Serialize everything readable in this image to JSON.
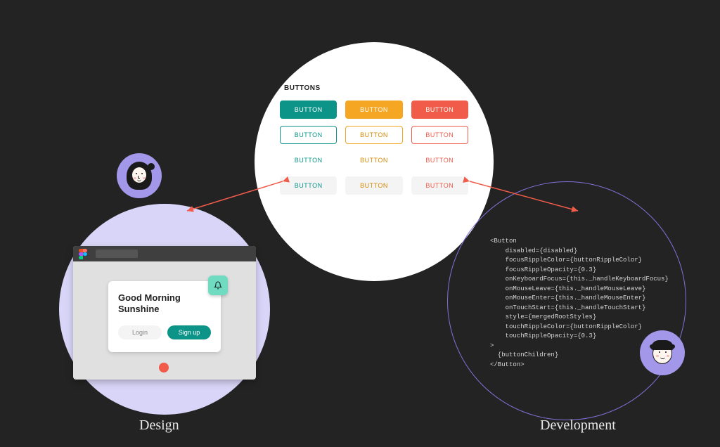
{
  "labels": {
    "design": "Design",
    "development": "Development"
  },
  "center": {
    "title": "BUTTONS",
    "button_text": "BUTTON"
  },
  "colors": {
    "teal": "#0d9488",
    "amber": "#f5a623",
    "red": "#f05b4a",
    "lavender": "#d9d5f8",
    "avatar": "#a397ea",
    "bg": "#232323"
  },
  "mockup": {
    "title_line1": "Good Morning",
    "title_line2": "Sunshine",
    "login": "Login",
    "signup": "Sign up"
  },
  "code": {
    "l0": "<Button",
    "l1": "    disabled={disabled}",
    "l2": "    focusRippleColor={buttonRippleColor}",
    "l3": "    focusRippleOpacity={0.3}",
    "l4": "    onKeyboardFocus={this._handleKeyboardFocus}",
    "l5": "    onMouseLeave={this._handleMouseLeave}",
    "l6": "    onMouseEnter={this._handleMouseEnter}",
    "l7": "    onTouchStart={this._handleTouchStart}",
    "l8": "    style={mergedRootStyles}",
    "l9": "    touchRippleColor={buttonRippleColor}",
    "l10": "    touchRippleOpacity={0.3}",
    "l11": ">",
    "l12": "  {buttonChildren}",
    "l13": "</Button>"
  }
}
